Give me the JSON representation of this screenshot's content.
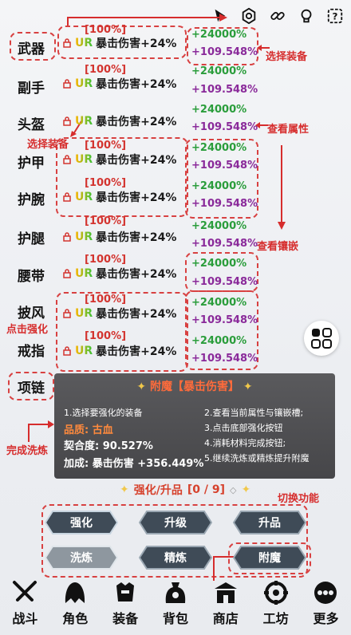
{
  "slots": [
    "武器",
    "副手",
    "头盔",
    "护甲",
    "护腕",
    "护腿",
    "腰带",
    "披风",
    "戒指",
    "项链"
  ],
  "items": [
    {
      "pct": "[100%]",
      "grade": "UR",
      "stat": "暴击伤害+24%",
      "flat": "+24000%",
      "mult": "+109.548%"
    },
    {
      "pct": "[100%]",
      "grade": "UR",
      "stat": "暴击伤害+24%",
      "flat": "+24000%",
      "mult": "+109.548%"
    },
    {
      "pct": "",
      "grade": "UR",
      "stat": "暴击伤害+24%",
      "flat": "+24000%",
      "mult": "+109.548%"
    },
    {
      "pct": "[100%]",
      "grade": "UR",
      "stat": "暴击伤害+24%",
      "flat": "+24000%",
      "mult": "+109.548%"
    },
    {
      "pct": "[100%]",
      "grade": "UR",
      "stat": "暴击伤害+24%",
      "flat": "+24000%",
      "mult": "+109.548%"
    },
    {
      "pct": "[100%]",
      "grade": "UR",
      "stat": "暴击伤害+24%",
      "flat": "+24000%",
      "mult": "+109.548%"
    },
    {
      "pct": "[100%]",
      "grade": "UR",
      "stat": "暴击伤害+24%",
      "flat": "+24000%",
      "mult": "+109.548%"
    },
    {
      "pct": "[100%]",
      "grade": "UR",
      "stat": "暴击伤害+24%",
      "flat": "+24000%",
      "mult": "+109.548%"
    },
    {
      "pct": "[100%]",
      "grade": "UR",
      "stat": "暴击伤害+24%",
      "flat": "+24000%",
      "mult": "+109.548%"
    }
  ],
  "annotations": {
    "select_equip_1": "选择装备",
    "select_equip_2": "选择装备",
    "view_attr": "查看属性",
    "view_inlay": "查看镶嵌",
    "click_strengthen": "点击强化",
    "finish_wash": "完成洗炼",
    "switch_func": "切换功能"
  },
  "panel": {
    "title": "附魔【暴击伤害】",
    "steps_left": [
      "1.选择要强化的装备",
      "2.查看当前属性与镶嵌槽;"
    ],
    "steps_right": [
      "3.点击底部强化按钮",
      "4.消耗材料完成按钮;",
      "5.继续洗炼或精炼提升附魔"
    ],
    "quality_label": "品质:",
    "quality_value": "古血",
    "fit": "契合度: 90.527%",
    "bonus": "加成: 暴击伤害 +356.449%"
  },
  "forge": {
    "title": "强化/升品",
    "count": "[0 / 9]"
  },
  "actions": [
    "强化",
    "升级",
    "升品",
    "洗炼",
    "精炼",
    "附魔"
  ],
  "nav": [
    "战斗",
    "角色",
    "装备",
    "背包",
    "商店",
    "工坊",
    "更多"
  ],
  "colors": {
    "accent_red": "#d62d2d",
    "green": "#2a9d3b",
    "purple": "#8a2a9a"
  }
}
